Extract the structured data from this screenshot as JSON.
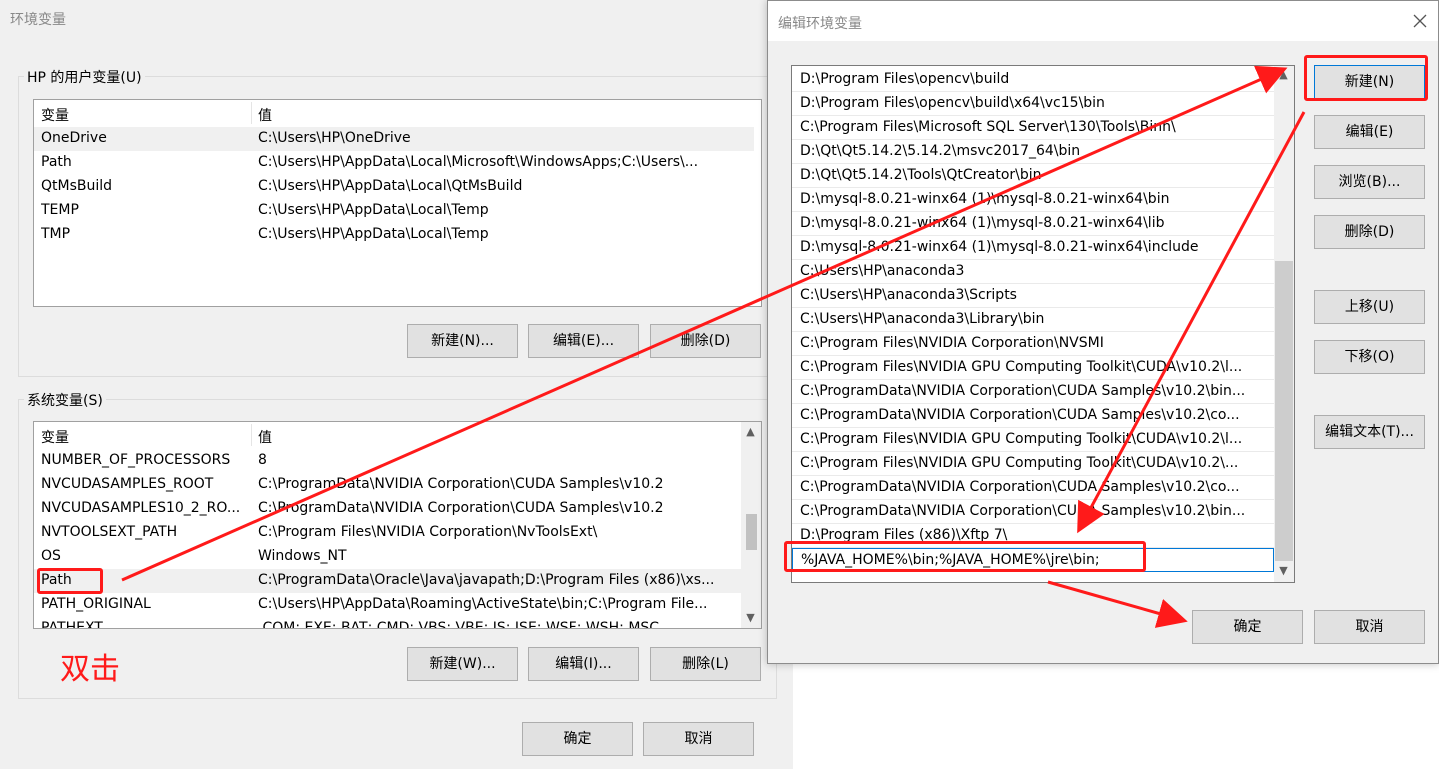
{
  "env_dialog": {
    "title": "环境变量",
    "user_group_label": "HP 的用户变量(U)",
    "user_headers": [
      "变量",
      "值"
    ],
    "user_rows": [
      {
        "name": "OneDrive",
        "value": "C:\\Users\\HP\\OneDrive"
      },
      {
        "name": "Path",
        "value": "C:\\Users\\HP\\AppData\\Local\\Microsoft\\WindowsApps;C:\\Users\\..."
      },
      {
        "name": "QtMsBuild",
        "value": "C:\\Users\\HP\\AppData\\Local\\QtMsBuild"
      },
      {
        "name": "TEMP",
        "value": "C:\\Users\\HP\\AppData\\Local\\Temp"
      },
      {
        "name": "TMP",
        "value": "C:\\Users\\HP\\AppData\\Local\\Temp"
      }
    ],
    "user_buttons": [
      "新建(N)...",
      "编辑(E)...",
      "删除(D)"
    ],
    "system_group_label": "系统变量(S)",
    "system_headers": [
      "变量",
      "值"
    ],
    "system_rows": [
      {
        "name": "NUMBER_OF_PROCESSORS",
        "value": "8"
      },
      {
        "name": "NVCUDASAMPLES_ROOT",
        "value": "C:\\ProgramData\\NVIDIA Corporation\\CUDA Samples\\v10.2"
      },
      {
        "name": "NVCUDASAMPLES10_2_RO...",
        "value": "C:\\ProgramData\\NVIDIA Corporation\\CUDA Samples\\v10.2"
      },
      {
        "name": "NVTOOLSEXT_PATH",
        "value": "C:\\Program Files\\NVIDIA Corporation\\NvToolsExt\\"
      },
      {
        "name": "OS",
        "value": "Windows_NT"
      },
      {
        "name": "Path",
        "value": "C:\\ProgramData\\Oracle\\Java\\javapath;D:\\Program Files (x86)\\xs..."
      },
      {
        "name": "PATH_ORIGINAL",
        "value": "C:\\Users\\HP\\AppData\\Roaming\\ActiveState\\bin;C:\\Program File..."
      },
      {
        "name": "PATHEXT",
        "value": ".COM;.EXE;.BAT;.CMD;.VBS;.VBE;.JS;.JSE;.WSF;.WSH;.MSC"
      }
    ],
    "system_buttons": [
      "新建(W)...",
      "编辑(I)...",
      "删除(L)"
    ],
    "ok": "确定",
    "cancel": "取消"
  },
  "annotation": {
    "double_click": "双击",
    "color": "#ff1a1a"
  },
  "edit_dialog": {
    "title": "编辑环境变量",
    "close_icon": "close-icon",
    "paths": [
      "D:\\Program Files\\opencv\\build",
      "D:\\Program Files\\opencv\\build\\x64\\vc15\\bin",
      "C:\\Program Files\\Microsoft SQL Server\\130\\Tools\\Binn\\",
      "D:\\Qt\\Qt5.14.2\\5.14.2\\msvc2017_64\\bin",
      "D:\\Qt\\Qt5.14.2\\Tools\\QtCreator\\bin",
      "D:\\mysql-8.0.21-winx64 (1)\\mysql-8.0.21-winx64\\bin",
      "D:\\mysql-8.0.21-winx64 (1)\\mysql-8.0.21-winx64\\lib",
      "D:\\mysql-8.0.21-winx64 (1)\\mysql-8.0.21-winx64\\include",
      "C:\\Users\\HP\\anaconda3",
      "C:\\Users\\HP\\anaconda3\\Scripts",
      "C:\\Users\\HP\\anaconda3\\Library\\bin",
      "C:\\Program Files\\NVIDIA Corporation\\NVSMI",
      "C:\\Program Files\\NVIDIA GPU Computing Toolkit\\CUDA\\v10.2\\l...",
      "C:\\ProgramData\\NVIDIA Corporation\\CUDA Samples\\v10.2\\bin...",
      "C:\\ProgramData\\NVIDIA Corporation\\CUDA Samples\\v10.2\\co...",
      "C:\\Program Files\\NVIDIA GPU Computing Toolkit\\CUDA\\v10.2\\l...",
      "C:\\Program Files\\NVIDIA GPU Computing Toolkit\\CUDA\\v10.2\\...",
      "C:\\ProgramData\\NVIDIA Corporation\\CUDA Samples\\v10.2\\co...",
      "C:\\ProgramData\\NVIDIA Corporation\\CUDA Samples\\v10.2\\bin...",
      "D:\\Program Files (x86)\\Xftp 7\\",
      "%JAVA_HOME%\\bin;%JAVA_HOME%\\jre\\bin;"
    ],
    "buttons": {
      "new": "新建(N)",
      "edit": "编辑(E)",
      "browse": "浏览(B)...",
      "delete": "删除(D)",
      "move_up": "上移(U)",
      "move_down": "下移(O)",
      "edit_text": "编辑文本(T)..."
    },
    "ok": "确定",
    "cancel": "取消"
  }
}
